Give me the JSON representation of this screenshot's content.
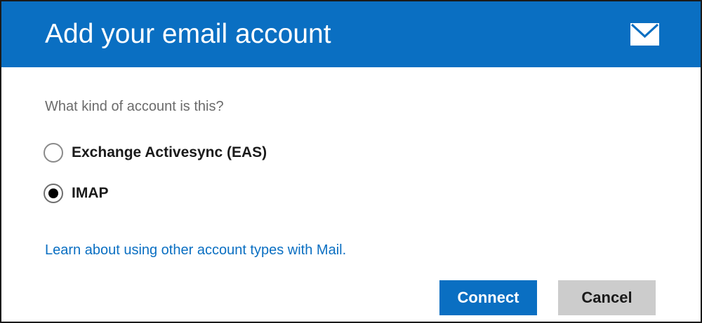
{
  "header": {
    "title": "Add your email account",
    "icon": "mail-icon",
    "background_color": "#0a6fc2"
  },
  "prompt": {
    "question": "What kind of account is this?"
  },
  "account_types": {
    "options": [
      {
        "label": "Exchange Activesync (EAS)",
        "selected": false
      },
      {
        "label": "IMAP",
        "selected": true
      }
    ]
  },
  "links": {
    "learn_more": "Learn about using other account types with Mail."
  },
  "buttons": {
    "connect_label": "Connect",
    "cancel_label": "Cancel",
    "connect_color": "#0a6fc2",
    "cancel_color": "#cccccc"
  }
}
